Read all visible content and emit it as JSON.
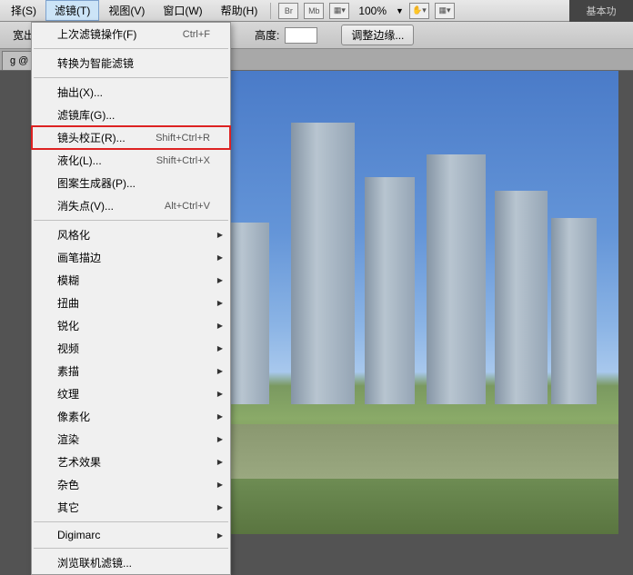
{
  "menubar": {
    "items": [
      {
        "label": "择(S)"
      },
      {
        "label": "滤镜(T)"
      },
      {
        "label": "视图(V)"
      },
      {
        "label": "窗口(W)"
      },
      {
        "label": "帮助(H)"
      }
    ]
  },
  "toolbar_icons": {
    "br": "Br",
    "mb": "Mb",
    "zoom": "100%"
  },
  "right_label": "基本功",
  "options": {
    "label1": "宽出",
    "label2": "高度:",
    "button": "调整边缘..."
  },
  "tab": {
    "label": "g @"
  },
  "dropdown": {
    "items": [
      {
        "label": "上次滤镜操作(F)",
        "shortcut": "Ctrl+F",
        "sep_after": true
      },
      {
        "label": "转换为智能滤镜",
        "sep_after": true
      },
      {
        "label": "抽出(X)..."
      },
      {
        "label": "滤镜库(G)..."
      },
      {
        "label": "镜头校正(R)...",
        "shortcut": "Shift+Ctrl+R",
        "highlighted": true
      },
      {
        "label": "液化(L)...",
        "shortcut": "Shift+Ctrl+X"
      },
      {
        "label": "图案生成器(P)..."
      },
      {
        "label": "消失点(V)...",
        "shortcut": "Alt+Ctrl+V",
        "sep_after": true
      },
      {
        "label": "风格化",
        "submenu": true
      },
      {
        "label": "画笔描边",
        "submenu": true
      },
      {
        "label": "模糊",
        "submenu": true
      },
      {
        "label": "扭曲",
        "submenu": true
      },
      {
        "label": "锐化",
        "submenu": true
      },
      {
        "label": "视频",
        "submenu": true
      },
      {
        "label": "素描",
        "submenu": true
      },
      {
        "label": "纹理",
        "submenu": true
      },
      {
        "label": "像素化",
        "submenu": true
      },
      {
        "label": "渲染",
        "submenu": true
      },
      {
        "label": "艺术效果",
        "submenu": true
      },
      {
        "label": "杂色",
        "submenu": true
      },
      {
        "label": "其它",
        "submenu": true,
        "sep_after": true
      },
      {
        "label": "Digimarc",
        "submenu": true,
        "sep_after": true
      },
      {
        "label": "浏览联机滤镜..."
      }
    ]
  }
}
